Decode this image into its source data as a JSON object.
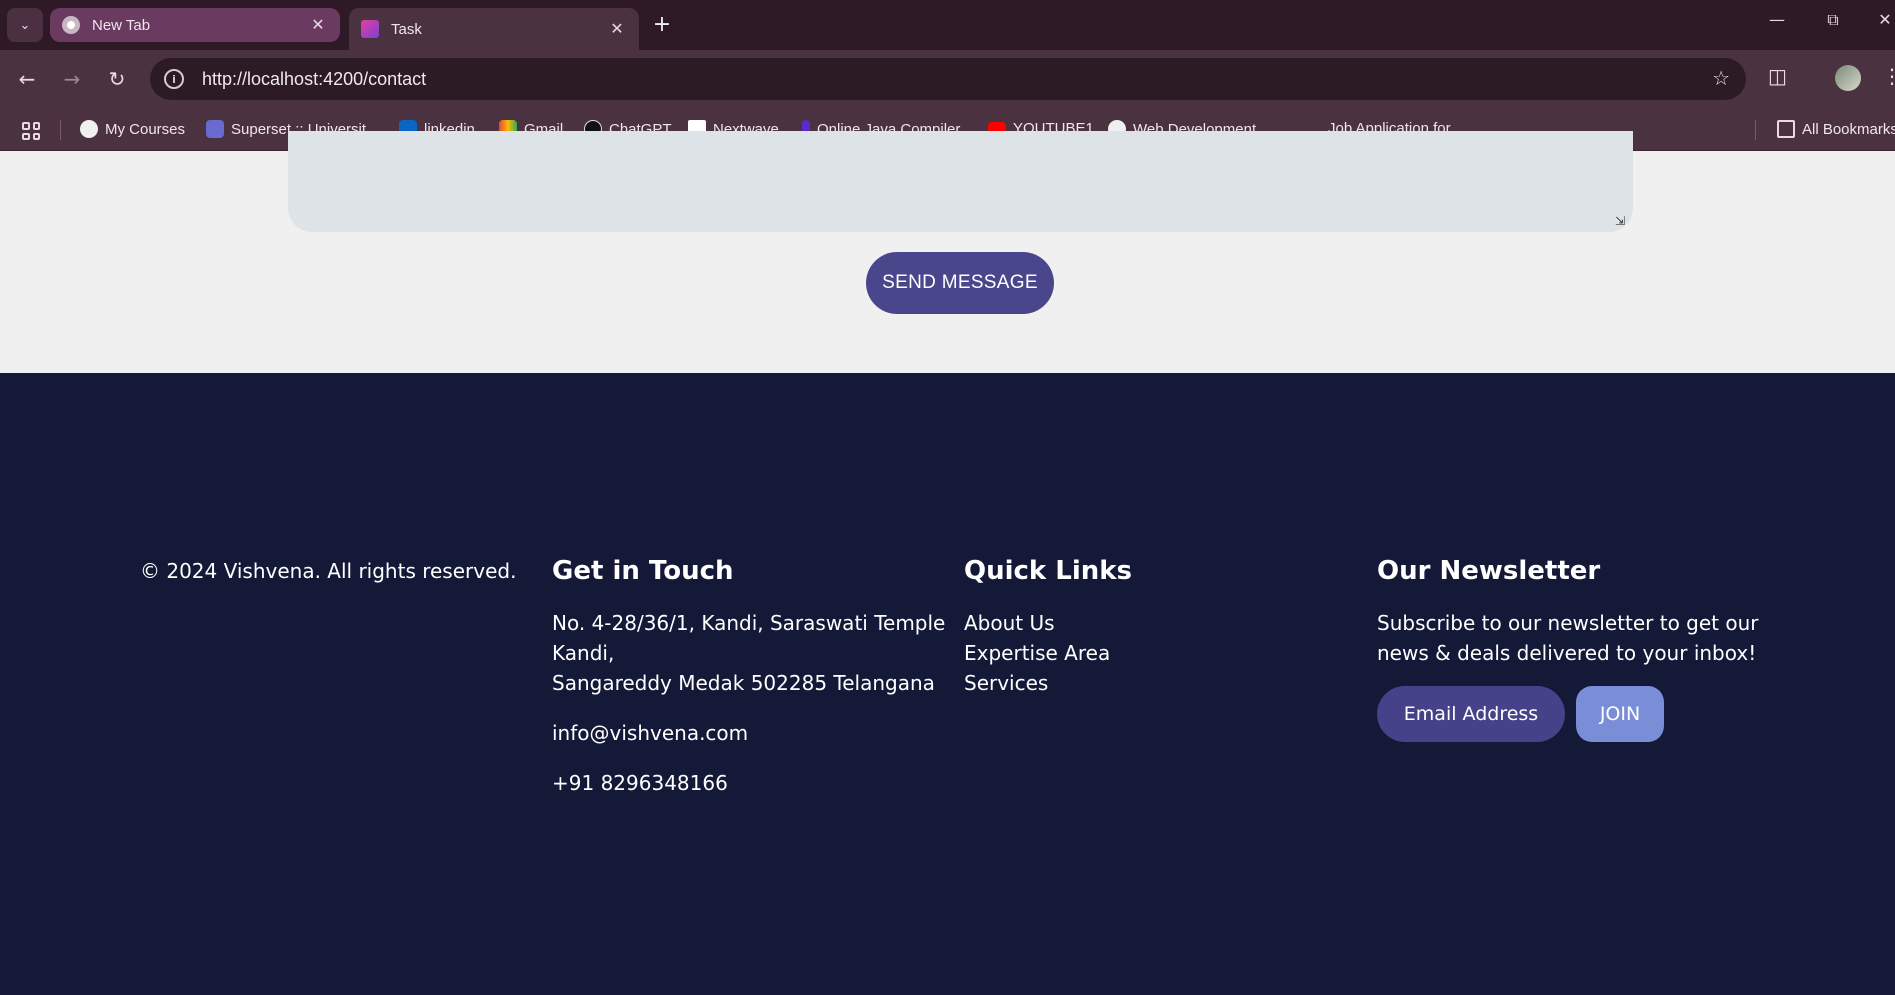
{
  "browser": {
    "tabs": [
      {
        "title": "New Tab",
        "favicon": "chrome-icon"
      },
      {
        "title": "Task",
        "favicon": "angular-icon"
      }
    ],
    "url": "http://localhost:4200/contact",
    "bookmarks": [
      {
        "label": "My Courses"
      },
      {
        "label": "Superset :: Universit..."
      },
      {
        "label": "linkedin"
      },
      {
        "label": "Gmail"
      },
      {
        "label": "ChatGPT"
      },
      {
        "label": "Nextwave"
      },
      {
        "label": "Online Java Compiler"
      },
      {
        "label": "YOUTUBE1"
      },
      {
        "label": "Web Development..."
      },
      {
        "label": "Job Application for..."
      }
    ],
    "all_bookmarks": "All Bookmarks"
  },
  "form": {
    "send_label": "SEND MESSAGE"
  },
  "footer": {
    "copyright": "© 2024 Vishvena. All rights reserved.",
    "contact": {
      "heading": "Get in Touch",
      "address_line1": "No. 4-28/36/1, Kandi, Saraswati Temple",
      "address_line2": "Kandi,",
      "address_line3": "Sangareddy Medak 502285 Telangana",
      "email": "info@vishvena.com",
      "phone": "+91 8296348166"
    },
    "quick_links": {
      "heading": "Quick Links",
      "links": [
        "About Us",
        "Expertise Area",
        "Services"
      ]
    },
    "newsletter": {
      "heading": "Our Newsletter",
      "text_line1": "Subscribe to our newsletter to get our",
      "text_line2": "news & deals delivered to your inbox!",
      "email_label": "Email Address",
      "join_label": "JOIN"
    }
  },
  "colors": {
    "footer_bg": "#141938",
    "button": "#4a468c",
    "join": "#7a8ed8"
  }
}
